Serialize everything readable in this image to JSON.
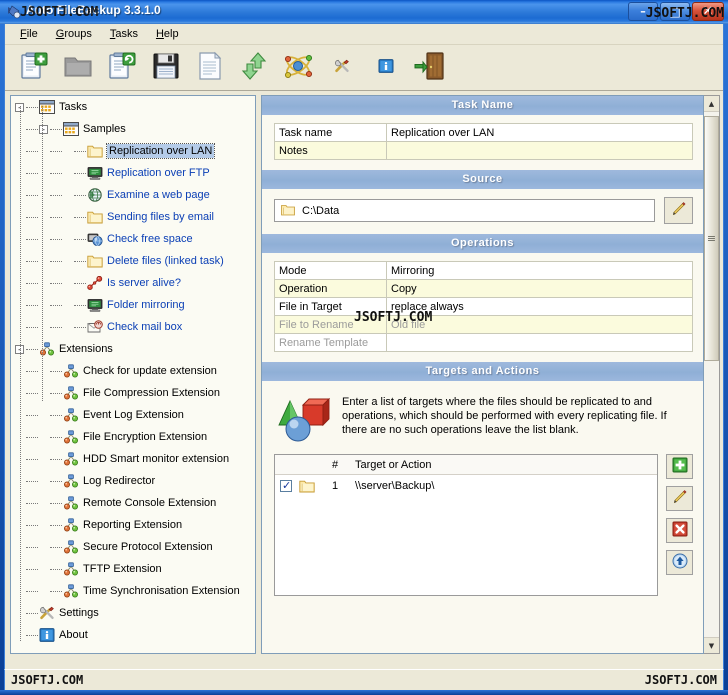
{
  "window": {
    "title": "Auto FileBackup 3.3.1.0",
    "watermark": "JSOFTJ.COM",
    "minimize_label": "–",
    "maximize_label": "□",
    "close_label": "✕"
  },
  "menu": {
    "items": [
      {
        "acc": "F",
        "rest": "ile"
      },
      {
        "acc": "G",
        "rest": "roups"
      },
      {
        "acc": "T",
        "rest": "asks"
      },
      {
        "acc": "H",
        "rest": "elp"
      }
    ]
  },
  "toolbar": {
    "buttons": [
      {
        "name": "new-task-button",
        "icon": "new-task-icon"
      },
      {
        "name": "open-task-button",
        "icon": "open-folder-icon"
      },
      {
        "name": "refresh-task-button",
        "icon": "refresh-task-icon"
      },
      {
        "name": "save-button",
        "icon": "floppy-save-icon"
      },
      {
        "name": "log-button",
        "icon": "document-log-icon"
      },
      {
        "name": "import-export-button",
        "icon": "updown-arrows-icon"
      },
      {
        "name": "extensions-button",
        "icon": "atom-extensions-icon"
      },
      {
        "name": "settings-button",
        "icon": "tools-settings-icon"
      },
      {
        "name": "about-button",
        "icon": "info-icon"
      },
      {
        "name": "exit-button",
        "icon": "exit-door-icon"
      }
    ]
  },
  "tree": {
    "nodes": [
      {
        "label": "Tasks",
        "depth": 0,
        "toggle": "-",
        "icon": "window-group-icon",
        "link": false,
        "selected": false
      },
      {
        "label": "Samples",
        "depth": 1,
        "toggle": "-",
        "icon": "window-group-icon",
        "link": false,
        "selected": false
      },
      {
        "label": "Replication over LAN",
        "depth": 2,
        "toggle": "",
        "icon": "folder-icon",
        "link": true,
        "selected": true
      },
      {
        "label": "Replication over FTP",
        "depth": 2,
        "toggle": "",
        "icon": "monitor-icon",
        "link": true,
        "selected": false
      },
      {
        "label": "Examine a web page",
        "depth": 2,
        "toggle": "",
        "icon": "globe-icon",
        "link": true,
        "selected": false
      },
      {
        "label": "Sending files by email",
        "depth": 2,
        "toggle": "",
        "icon": "folder-icon",
        "link": true,
        "selected": false
      },
      {
        "label": "Check free space",
        "depth": 2,
        "toggle": "",
        "icon": "disk-globe-icon",
        "link": true,
        "selected": false
      },
      {
        "label": "Delete files (linked task)",
        "depth": 2,
        "toggle": "",
        "icon": "folder-icon",
        "link": true,
        "selected": false
      },
      {
        "label": "Is server alive?",
        "depth": 2,
        "toggle": "",
        "icon": "ping-dots-icon",
        "link": true,
        "selected": false
      },
      {
        "label": "Folder mirroring",
        "depth": 2,
        "toggle": "",
        "icon": "monitor-icon",
        "link": true,
        "selected": false
      },
      {
        "label": "Check mail box",
        "depth": 2,
        "toggle": "",
        "icon": "mail-icon",
        "link": true,
        "selected": false
      },
      {
        "label": "Extensions",
        "depth": 0,
        "toggle": "-",
        "icon": "extension-node-icon",
        "link": false,
        "selected": false
      },
      {
        "label": "Check for update extension",
        "depth": 1,
        "toggle": "",
        "icon": "extension-node-icon",
        "link": false,
        "selected": false
      },
      {
        "label": "File Compression Extension",
        "depth": 1,
        "toggle": "",
        "icon": "extension-node-icon",
        "link": false,
        "selected": false
      },
      {
        "label": "Event Log Extension",
        "depth": 1,
        "toggle": "",
        "icon": "extension-node-icon",
        "link": false,
        "selected": false
      },
      {
        "label": "File Encryption Extension",
        "depth": 1,
        "toggle": "",
        "icon": "extension-node-icon",
        "link": false,
        "selected": false
      },
      {
        "label": "HDD Smart monitor extension",
        "depth": 1,
        "toggle": "",
        "icon": "extension-node-icon",
        "link": false,
        "selected": false
      },
      {
        "label": "Log Redirector",
        "depth": 1,
        "toggle": "",
        "icon": "extension-node-icon",
        "link": false,
        "selected": false
      },
      {
        "label": "Remote Console Extension",
        "depth": 1,
        "toggle": "",
        "icon": "extension-node-icon",
        "link": false,
        "selected": false
      },
      {
        "label": "Reporting Extension",
        "depth": 1,
        "toggle": "",
        "icon": "extension-node-icon",
        "link": false,
        "selected": false
      },
      {
        "label": "Secure Protocol Extension",
        "depth": 1,
        "toggle": "",
        "icon": "extension-node-icon",
        "link": false,
        "selected": false
      },
      {
        "label": "TFTP Extension",
        "depth": 1,
        "toggle": "",
        "icon": "extension-node-icon",
        "link": false,
        "selected": false
      },
      {
        "label": "Time Synchronisation Extension",
        "depth": 1,
        "toggle": "",
        "icon": "extension-node-icon",
        "link": false,
        "selected": false
      },
      {
        "label": "Settings",
        "depth": 0,
        "toggle": "",
        "icon": "tools-settings-icon",
        "link": false,
        "selected": false
      },
      {
        "label": "About",
        "depth": 0,
        "toggle": "",
        "icon": "info-icon",
        "link": false,
        "selected": false
      }
    ]
  },
  "detail": {
    "task_name": {
      "header": "Task Name",
      "rows": [
        {
          "key": "Task name",
          "value": "Replication over LAN",
          "disabled": false
        },
        {
          "key": "Notes",
          "value": "",
          "disabled": false
        }
      ]
    },
    "source": {
      "header": "Source",
      "path": "C:\\Data",
      "edit_icon": "pencil-edit-icon"
    },
    "operations": {
      "header": "Operations",
      "watermark": "JSOFTJ.COM",
      "rows": [
        {
          "key": "Mode",
          "value": "Mirroring",
          "disabled": false
        },
        {
          "key": "Operation",
          "value": "Copy",
          "disabled": false
        },
        {
          "key": "File in Target",
          "value": "replace always",
          "disabled": false
        },
        {
          "key": "File to Rename",
          "value": "Old file",
          "disabled": true
        },
        {
          "key": "Rename Template",
          "value": "",
          "disabled": true
        }
      ]
    },
    "targets": {
      "header": "Targets and Actions",
      "description": "Enter a list of targets where the files should be replicated to and operations, which should be performed with every replicating file. If there are no such operations leave the list blank.",
      "columns": {
        "num": "#",
        "target": "Target or Action"
      },
      "rows": [
        {
          "checked": true,
          "num": "1",
          "target": "\\\\server\\Backup\\",
          "icon": "folder-icon"
        }
      ],
      "buttons": [
        {
          "name": "add-target-button",
          "icon": "green-plus-icon"
        },
        {
          "name": "edit-target-button",
          "icon": "pencil-edit-icon"
        },
        {
          "name": "delete-target-button",
          "icon": "red-x-icon"
        },
        {
          "name": "move-up-button",
          "icon": "blue-up-arrow-icon"
        }
      ]
    }
  },
  "scrollbar": {
    "up_arrow": "▲",
    "down_arrow": "▼"
  },
  "status": {
    "left": "JSOFTJ.COM",
    "right": "JSOFTJ.COM"
  },
  "colors": {
    "title_blue": "#2d7ad9",
    "section_header": "#8fafd6",
    "selection": "#b4cbe8",
    "row_alt": "#fbfbdd",
    "link_text": "#0b3fb5",
    "client_bg": "#ece9d8"
  }
}
